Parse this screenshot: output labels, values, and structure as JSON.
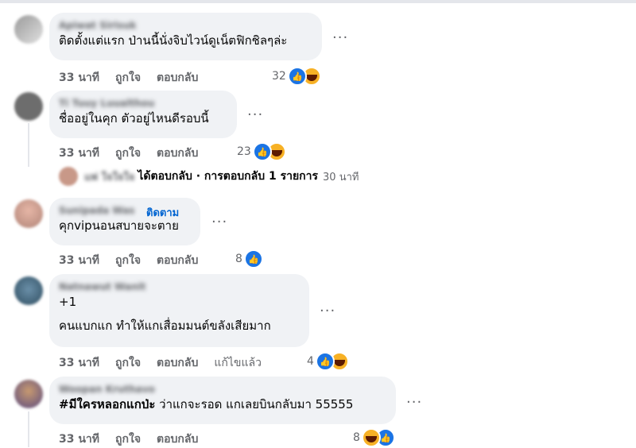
{
  "colors": {
    "bubble": "#f0f2f5",
    "meta": "#65676b",
    "like": "#1b74e4",
    "haha": "#f7b125",
    "follow": "#0064d1"
  },
  "comments": [
    {
      "author": "Apiwat Sirisuk",
      "text": "ติดตั้งแต่แรก ป่านนี้นั่งจิบไวน์ดูเน็ตฟิกชิลๆล่ะ",
      "time": "33 นาที",
      "like": "ถูกใจ",
      "reply": "ตอบกลับ",
      "reaction_count": "32",
      "reactions": [
        "like-icon",
        "haha-icon"
      ]
    },
    {
      "author": "Ti Tuuy Luualthou",
      "text": "ชื่ออยู่ในคุก ตัวอยู่ไหนดีรอบนี้",
      "time": "33 นาที",
      "like": "ถูกใจ",
      "reply": "ตอบกลับ",
      "reaction_count": "23",
      "reactions": [
        "like-icon",
        "haha-icon"
      ],
      "reply_summary": {
        "name": "แพ่ ใจใจใจ",
        "text": "ได้ตอบกลับ · การตอบกลับ 1 รายการ",
        "time": "30 นาที"
      }
    },
    {
      "author": "Sunipada Was",
      "follow": "ติดตาม",
      "text": "คุกvipนอนสบายจะตาย",
      "time": "33 นาที",
      "like": "ถูกใจ",
      "reply": "ตอบกลับ",
      "reaction_count": "8",
      "reactions": [
        "like-icon"
      ]
    },
    {
      "author": "Natnawut Wanit",
      "text_line1": "+1",
      "text_line2": "คนแบกแก ทำให้แกเสื่อมมนต์ขลังเสียมาก",
      "time": "33 นาที",
      "like": "ถูกใจ",
      "reply": "ตอบกลับ",
      "edited": "แก้ไขแล้ว",
      "reaction_count": "4",
      "reactions": [
        "like-icon",
        "haha-icon"
      ]
    },
    {
      "author": "Woopan Kruthavo",
      "hashtag": "#มีใครหลอกแกป่ะ",
      "text": " ว่าแกจะรอด แกเลยบินกลับมา 55555",
      "time": "33 นาที",
      "like": "ถูกใจ",
      "reply": "ตอบกลับ",
      "reaction_count": "8",
      "reactions": [
        "haha-icon",
        "like-icon"
      ]
    }
  ],
  "more_label": "···",
  "reply_arrow": "⮡"
}
